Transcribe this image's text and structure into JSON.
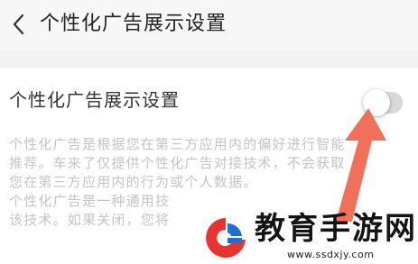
{
  "header": {
    "back_icon": "chevron-left-icon",
    "title": "个性化广告展示设置"
  },
  "setting": {
    "label": "个性化广告展示设置",
    "toggle_on": false
  },
  "description": {
    "lines": [
      "个性化广告是根据您在第三方应用内的偏好进行智能",
      "推荐。车来了仅提供个性化广告对接技术，不会获取",
      "您在第三方应用内的行为或个人数据。",
      "个性化广告是一种通用技",
      "该技术。如果关闭，您将"
    ]
  },
  "annotation": {
    "arrow_color": "#f0705a"
  },
  "watermark": {
    "brand": "教育手游网",
    "url": "www.ssdxjy.com",
    "logo_colors": [
      "#e8342f",
      "#1d6fd1"
    ]
  }
}
